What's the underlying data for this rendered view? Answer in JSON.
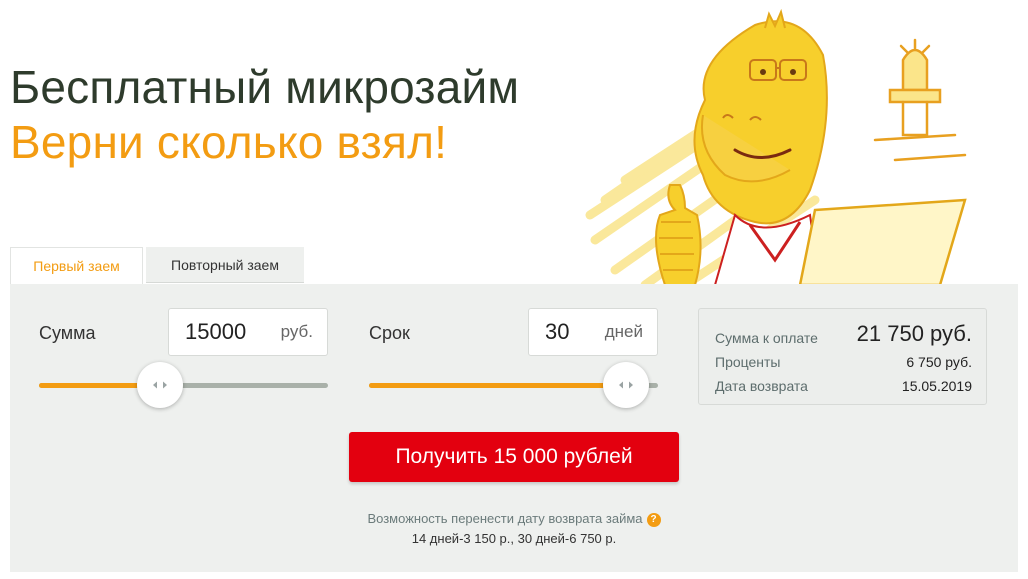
{
  "hero": {
    "title": "Бесплатный микрозайм",
    "subtitle": "Верни сколько взял!"
  },
  "tabs": [
    {
      "label": "Первый заем",
      "active": true
    },
    {
      "label": "Повторный заем",
      "active": false
    }
  ],
  "calculator": {
    "amount": {
      "label": "Сумма",
      "value": "15000",
      "unit": "руб.",
      "slider_fraction": 0.42
    },
    "term": {
      "label": "Срок",
      "value": "30",
      "unit": "дней",
      "slider_fraction": 0.89
    }
  },
  "summary": {
    "total_label": "Сумма к оплате",
    "total_value": "21 750 руб.",
    "interest_label": "Проценты",
    "interest_value": "6 750 руб.",
    "return_label": "Дата возврата",
    "return_value": "15.05.2019"
  },
  "cta": {
    "label": "Получить 15 000 рублей"
  },
  "note": {
    "line1": "Возможность перенести дату возврата займа",
    "help_icon": "?",
    "line2": "14 дней-3 150 р., 30 дней-6 750 р."
  },
  "colors": {
    "accent": "#f39c12",
    "cta": "#e3000f",
    "panel": "#eef0ee",
    "title": "#2e3b2c"
  },
  "icons": {
    "mascot": "camel-mascot-illustration",
    "slider_handle": "left-right-arrows-icon",
    "help": "question-icon"
  }
}
